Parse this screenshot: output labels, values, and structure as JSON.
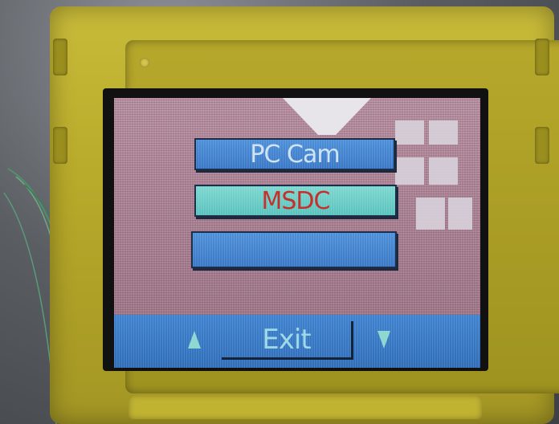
{
  "menu": {
    "items": [
      {
        "label": "PC Cam",
        "selected": false
      },
      {
        "label": "MSDC",
        "selected": true
      },
      {
        "label": "",
        "selected": false
      }
    ]
  },
  "bottom_bar": {
    "exit_label": "Exit",
    "up_icon": "triangle-up-icon",
    "down_icon": "triangle-down-icon"
  },
  "colors": {
    "button_blue": "#3a78c6",
    "button_selected": "#59c2bc",
    "selected_text": "#c4302c",
    "normal_text": "#cfe3f5",
    "housing_yellow": "#b8aa2a"
  }
}
